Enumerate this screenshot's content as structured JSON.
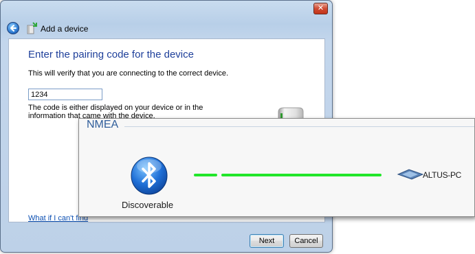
{
  "dialog": {
    "title": "Add a device",
    "close_symbol": "✕",
    "heading": "Enter the pairing code for the device",
    "description": "This will verify that you are connecting to the correct device.",
    "code_value": "1234",
    "help_text": "The code is either displayed on your device or in the information that came with the device.",
    "help_link": "What if I can't find",
    "buttons": {
      "next": "Next",
      "cancel": "Cancel"
    },
    "icons": {
      "back": "back-arrow-icon",
      "title": "add-device-icon",
      "device": "device-icon"
    }
  },
  "nmea_panel": {
    "title": "NMEA",
    "status_label": "Discoverable",
    "computer_name": "ALTUS-PC",
    "link_color": "#22e62a",
    "icons": {
      "bluetooth": "bluetooth-icon",
      "computer": "computer-icon"
    }
  },
  "colors": {
    "heading": "#1e3f9a",
    "link": "#0b4fb2",
    "nmea_title": "#2f5d9a"
  }
}
